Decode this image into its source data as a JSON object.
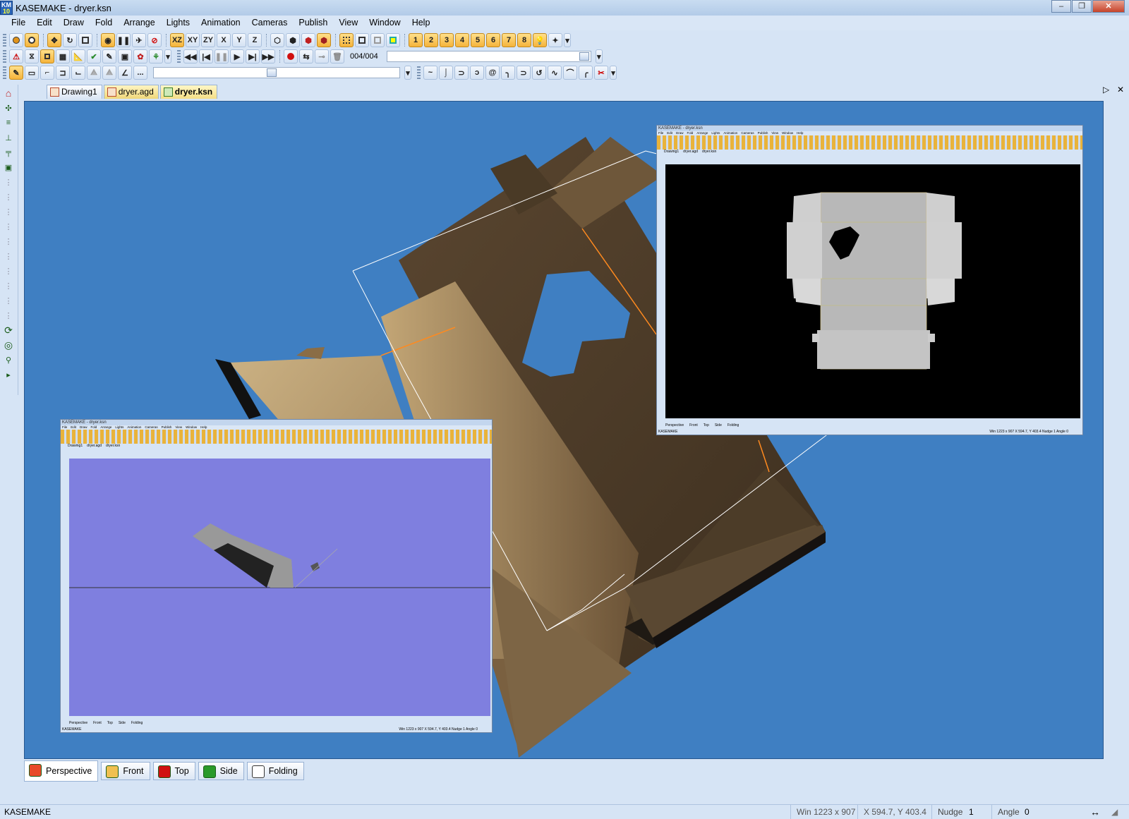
{
  "titlebar": {
    "app_badge_top": "KM",
    "app_badge_bottom": "10",
    "title": "KASEMAKE - dryer.ksn"
  },
  "menu": [
    "File",
    "Edit",
    "Draw",
    "Fold",
    "Arrange",
    "Lights",
    "Animation",
    "Cameras",
    "Publish",
    "View",
    "Window",
    "Help"
  ],
  "toolbar1": {
    "axis_labels": [
      "XZ",
      "XY",
      "ZY",
      "X",
      "Y",
      "Z"
    ]
  },
  "toolbar2": {
    "frame_counter": "004/004"
  },
  "toolbar3": {
    "more": "..."
  },
  "doc_tabs": [
    {
      "label": "Drawing1"
    },
    {
      "label": "dryer.agd"
    },
    {
      "label": "dryer.ksn"
    }
  ],
  "view_tabs": [
    "Perspective",
    "Front",
    "Top",
    "Side",
    "Folding"
  ],
  "inset_top": {
    "title": "KASEMAKE - dryer.ksn",
    "tabs": [
      "Drawing1",
      "dryer.agd",
      "dryer.ksn"
    ],
    "views": [
      "Perspective",
      "Front",
      "Top",
      "Side",
      "Folding"
    ],
    "status_left": "KASEMAKE",
    "status_right": "Win 1223 x 907   X 594.7, Y 403.4   Nudge 1   Angle 0"
  },
  "inset_bottom": {
    "title": "KASEMAKE - dryer.ksn",
    "tabs": [
      "Drawing1",
      "dryer.agd",
      "dryer.ksn"
    ],
    "views": [
      "Perspective",
      "Front",
      "Top",
      "Side",
      "Folding"
    ],
    "status_left": "KASEMAKE",
    "status_right": "Win 1223 x 907   X 594.7, Y 403.4   Nudge 1   Angle 0"
  },
  "status": {
    "app": "KASEMAKE",
    "win": "Win 1223 x 907",
    "coords": "X 594.7, Y 403.4",
    "nudge_label": "Nudge",
    "nudge_value": "1",
    "angle_label": "Angle",
    "angle_value": "0"
  },
  "colors": {
    "viewport_bg": "#3f7fc2",
    "board": "#4a3a26",
    "board_light": "#b89a6c",
    "side_view_bg": "#7f7fdf",
    "top_view_bg": "#000000",
    "highlight": "#f5b33b"
  }
}
